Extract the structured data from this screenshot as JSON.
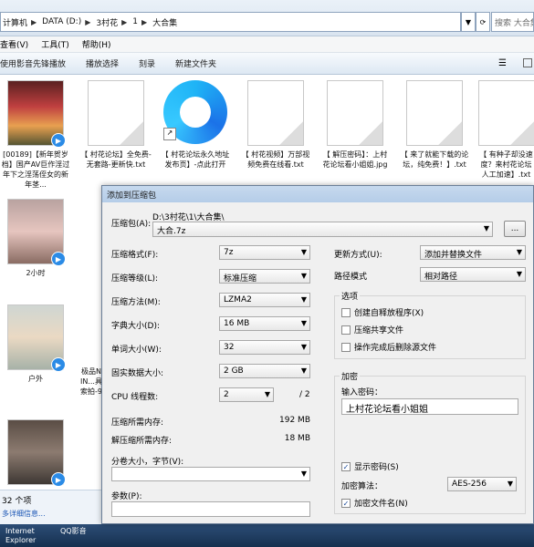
{
  "explorer": {
    "breadcrumbs": [
      "计算机",
      "DATA (D:)",
      "3村花",
      "1",
      "大合集"
    ],
    "search_placeholder": "搜索 大合集",
    "menu": [
      "查看(V)",
      "工具(T)",
      "帮助(H)"
    ],
    "toolbar": [
      "使用影音先锋播放",
      "播放选择",
      "刻录",
      "新建文件夹"
    ],
    "files": [
      {
        "name": "[00189]【新年贺岁档】国产AV巨作淫过年下之淫荡侄女的新年茎...",
        "kind": "video"
      },
      {
        "name": "【 村花论坛】全免费-无套路-更新快.txt",
        "kind": "doc"
      },
      {
        "name": "【 村花论坛永久地址发布页】-点此打开",
        "kind": "link"
      },
      {
        "name": "【 村花视频】万部视频免费在线看.txt",
        "kind": "doc"
      },
      {
        "name": "【 解压密码】：上村花论坛看小姐姐.jpg",
        "kind": "doc"
      },
      {
        "name": "【 来了就能下载的论坛，纯免费！】.txt",
        "kind": "doc"
      },
      {
        "name": "【 有种子却没速度？来村花论坛人工加速】.txt",
        "kind": "doc"
      },
      {
        "name": "2小时",
        "kind": "video-img1"
      },
      {
        "name": "户外",
        "kind": "video-img2"
      },
      {
        "name": "极品NIN...具索拍-9",
        "kind": "partial"
      },
      {
        "name": "",
        "kind": "video-img3"
      }
    ],
    "status_count": "32 个项",
    "status_more": "多详细信息...",
    "taskbar": [
      "Internet Explorer",
      "QQ影音"
    ]
  },
  "dialog": {
    "title": "添加到压缩包",
    "archive_label": "压缩包(A):",
    "archive_path": "D:\\3村花\\1\\大合集\\",
    "archive_name": "大合.7z",
    "browse_label": "...",
    "format_label": "压缩格式(F):",
    "format_value": "7z",
    "level_label": "压缩等级(L):",
    "level_value": "标准压缩",
    "method_label": "压缩方法(M):",
    "method_value": "LZMA2",
    "dict_label": "字典大小(D):",
    "dict_value": "16 MB",
    "word_label": "单词大小(W):",
    "word_value": "32",
    "solid_label": "固实数据大小:",
    "solid_value": "2 GB",
    "cpu_label": "CPU 线程数:",
    "cpu_value": "2",
    "cpu_total": "/ 2",
    "mem_comp_label": "压缩所需内存:",
    "mem_comp_value": "192 MB",
    "mem_decomp_label": "解压缩所需内存:",
    "mem_decomp_value": "18 MB",
    "split_label": "分卷大小，字节(V):",
    "params_label": "参数(P):",
    "update_label": "更新方式(U):",
    "update_value": "添加并替换文件",
    "path_label": "路径模式",
    "path_value": "相对路径",
    "options_label": "选项",
    "opt_sfx": "创建自释放程序(X)",
    "opt_shared": "压缩共享文件",
    "opt_delete": "操作完成后删除源文件",
    "encrypt_label": "加密",
    "password_label": "输入密码：",
    "password_value": "上村花论坛看小姐姐",
    "show_password": "显示密码(S)",
    "enc_method_label": "加密算法：",
    "enc_method_value": "AES-256",
    "enc_names": "加密文件名(N)",
    "check_mark": "✓"
  }
}
